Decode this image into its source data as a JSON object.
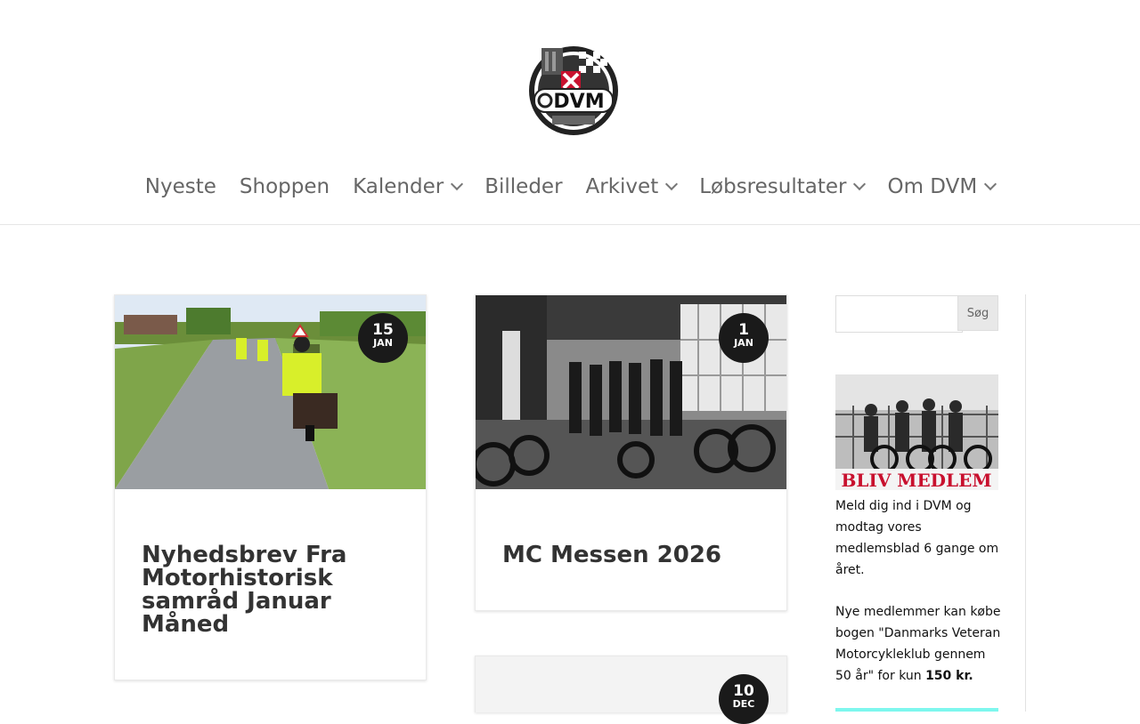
{
  "site": {
    "logo_text": "DVM"
  },
  "nav": {
    "items": [
      {
        "label": "Nyeste",
        "has_dropdown": false
      },
      {
        "label": "Shoppen",
        "has_dropdown": false
      },
      {
        "label": "Kalender",
        "has_dropdown": true
      },
      {
        "label": "Billeder",
        "has_dropdown": false
      },
      {
        "label": "Arkivet",
        "has_dropdown": true
      },
      {
        "label": "Løbsresultater",
        "has_dropdown": true
      },
      {
        "label": "Om DVM",
        "has_dropdown": true
      }
    ]
  },
  "posts": [
    {
      "day": "15",
      "month": "Jan",
      "title": "Nyhedsbrev Fra Motorhistorisk samråd Januar Måned"
    },
    {
      "day": "1",
      "month": "Jan",
      "title": "MC Messen 2026"
    },
    {
      "day": "10",
      "month": "Dec",
      "title": ""
    }
  ],
  "sidebar": {
    "search_button": "Søg",
    "search_placeholder": "",
    "banner_text": "BLIV MEDLEM",
    "join_text": "Meld dig ind i DVM og modtag vores medlemsblad 6 gange om året.",
    "book_text_pre": "Nye medlemmer kan købe bogen \"Danmarks Veteran Motorcykleklub gennem 50 år\" for kun ",
    "book_price": "150 kr."
  },
  "colors": {
    "nav_text": "#666666",
    "badge_bg": "#1a1a1a",
    "banner_red": "#c8102e",
    "accent_cyan": "#7ef7ee"
  }
}
